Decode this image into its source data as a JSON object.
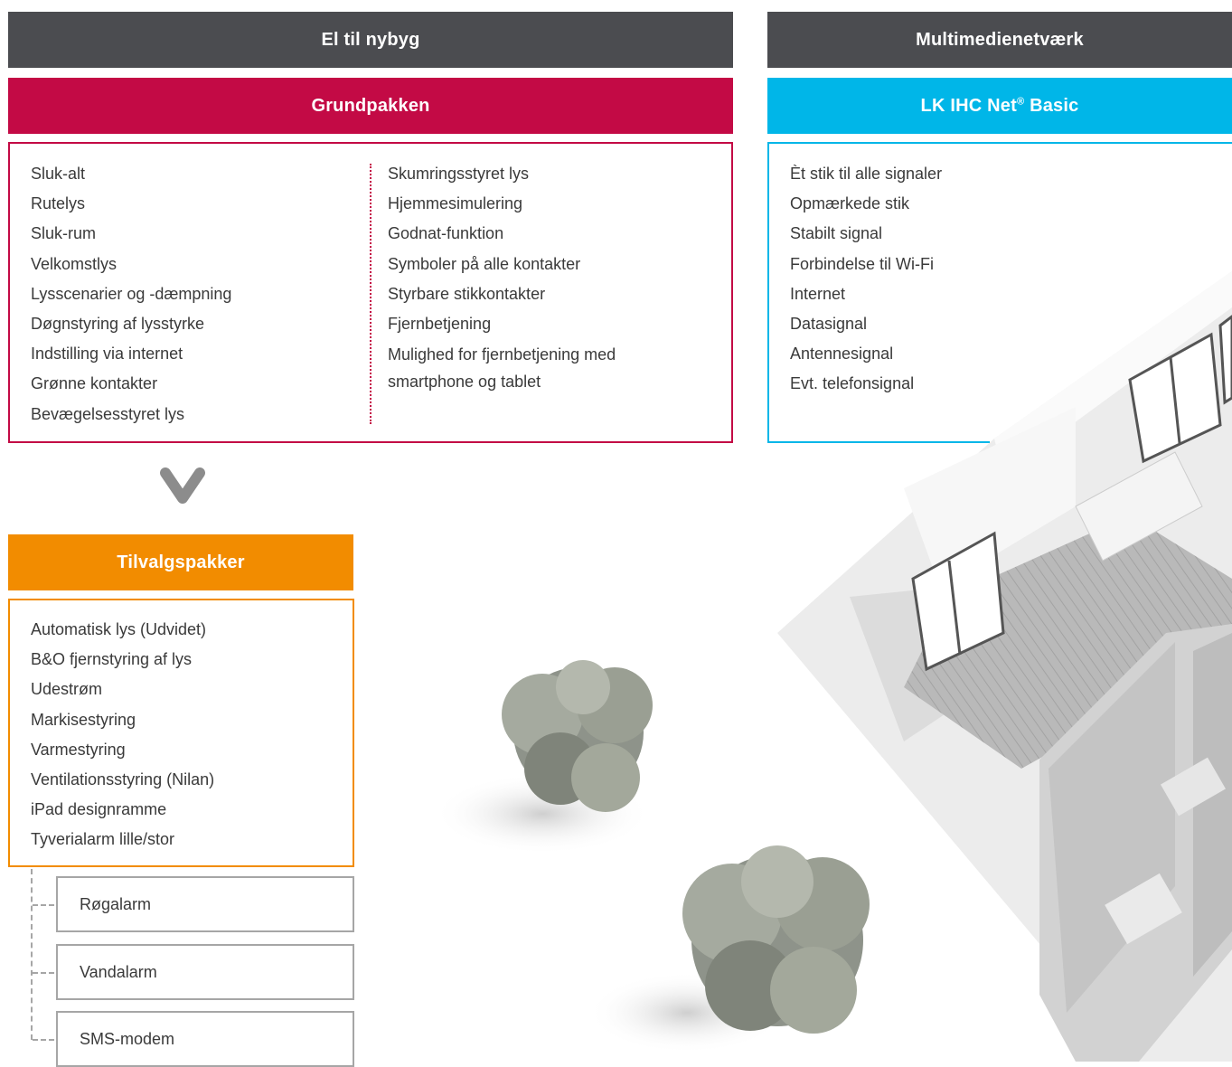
{
  "left_header": "El til nybyg",
  "right_header": "Multimedienetværk",
  "grundpakken": {
    "title": "Grundpakken",
    "col1": [
      "Sluk-alt",
      "Rutelys",
      "Sluk-rum",
      "Velkomstlys",
      "Lysscenarier og -dæmpning",
      "Døgnstyring af lysstyrke",
      "Indstilling via internet",
      "Grønne kontakter",
      "Bevægelsesstyret lys"
    ],
    "col2": [
      "Skumringsstyret lys",
      "Hjemmesimulering",
      "Godnat-funktion",
      "Symboler på alle kontakter",
      "Styrbare stikkontakter",
      "Fjernbetjening"
    ],
    "col2_last": "Mulighed for fjernbetjening med smartphone og tablet"
  },
  "basic": {
    "title_main": "LK IHC Net",
    "title_sup": "®",
    "title_end": " Basic",
    "items": [
      "Èt stik til alle signaler",
      "Opmærkede stik",
      "Stabilt signal",
      "Forbindelse til Wi-Fi",
      "Internet",
      "Datasignal",
      "Antennesignal",
      "Evt. telefonsignal"
    ]
  },
  "tilvalg": {
    "title": "Tilvalgspakker",
    "items": [
      "Automatisk lys (Udvidet)",
      "B&O fjernstyring af lys",
      "Udestrøm",
      "Markisestyring",
      "Varmestyring",
      "Ventilationsstyring (Nilan)",
      "iPad designramme",
      "Tyverialarm lille/stor"
    ],
    "sub_items": [
      "Røgalarm",
      "Vandalarm",
      "SMS-modem"
    ]
  },
  "colors": {
    "dark": "#4b4c50",
    "crimson": "#c30a45",
    "cyan": "#00b6e8",
    "orange": "#f28c00",
    "grey_border": "#a6a6a6"
  },
  "icons": [
    "chevron-down-icon"
  ]
}
